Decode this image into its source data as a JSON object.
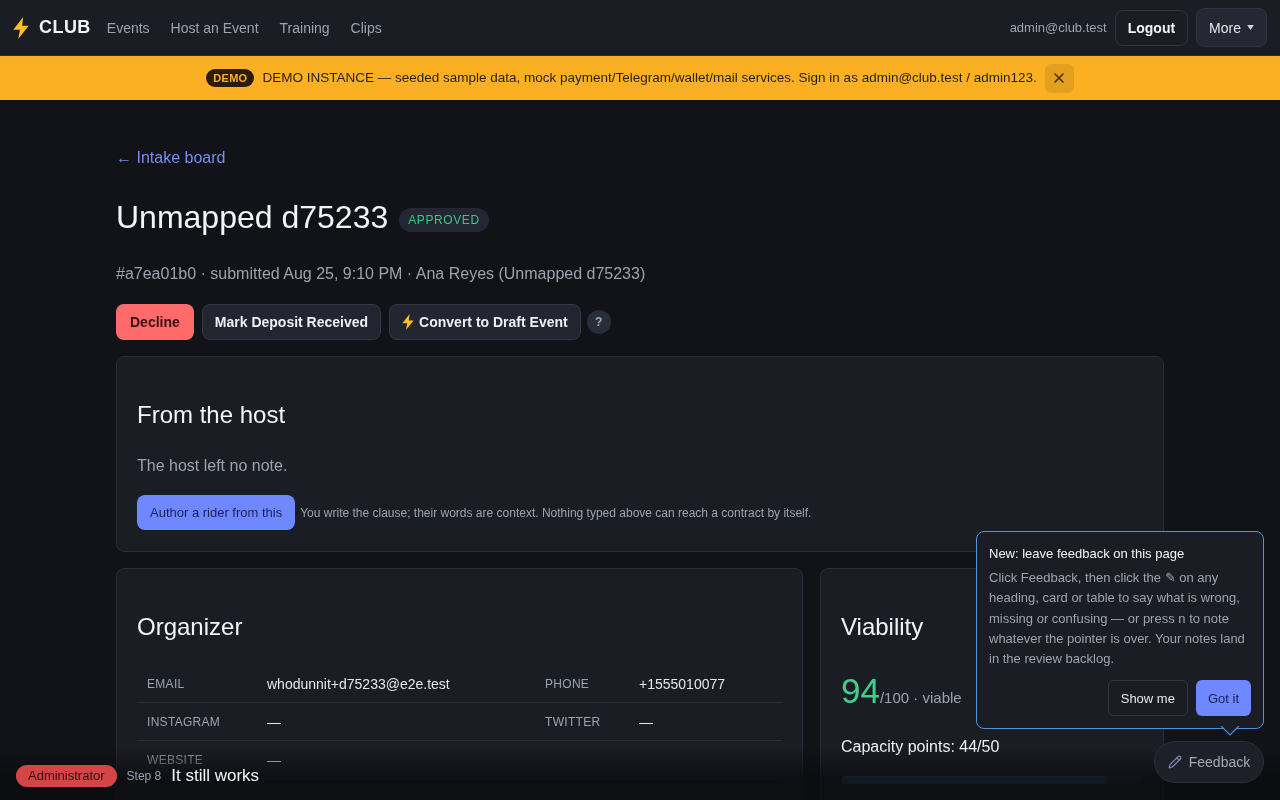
{
  "nav": {
    "logo": "CLUB",
    "links": [
      {
        "label": "Events"
      },
      {
        "label": "Host an Event"
      },
      {
        "label": "Training"
      },
      {
        "label": "Clips"
      }
    ],
    "user_email": "admin@club.test",
    "logout": "Logout",
    "more": "More"
  },
  "banner": {
    "badge": "DEMO",
    "text": "DEMO INSTANCE — seeded sample data, mock payment/Telegram/wallet/mail services. Sign in as admin@club.test / admin123."
  },
  "back_link": "← Intake board",
  "title": "Unmapped d75233",
  "status": "APPROVED",
  "meta": "#a7ea01b0 · submitted Aug 25, 9:10 PM · Ana Reyes (Unmapped d75233)",
  "actions": [
    {
      "label": "Decline",
      "kind": "danger"
    },
    {
      "label": "Mark Deposit Received",
      "kind": "plain"
    },
    {
      "label": "Convert to Draft Event",
      "kind": "flash"
    },
    {
      "label": "?",
      "kind": "help"
    }
  ],
  "host_card": {
    "title": "From the host",
    "note": "The host left no note.",
    "button": "Author a rider from this",
    "hint": "You write the clause; their words are context. Nothing typed above can reach a contract by itself."
  },
  "organizer": {
    "title": "Organizer",
    "rows": [
      {
        "cells": [
          {
            "label": "EMAIL",
            "value": "whodunnit+d75233@e2e.test"
          },
          {
            "label": "PHONE",
            "value": "+1555010077"
          }
        ]
      },
      {
        "cells": [
          {
            "label": "INSTAGRAM",
            "value": "—"
          },
          {
            "label": "TWITTER",
            "value": "—"
          }
        ]
      },
      {
        "cells": [
          {
            "label": "WEBSITE",
            "value": "—"
          }
        ]
      }
    ]
  },
  "viability": {
    "title": "Viability",
    "score": "94",
    "suffix": "/100 · viable",
    "capacity": "Capacity points: 44/50",
    "level": 0.88
  },
  "popover": {
    "title": "New: leave feedback on this page",
    "body": "Click Feedback, then click the ✎ on any heading, card or table to say what is wrong, missing or confusing — or press n to note whatever the pointer is over. Your notes land in the review backlog.",
    "buttons": [
      {
        "label": "Show me",
        "kind": "secondary"
      },
      {
        "label": "Got it",
        "kind": "primary"
      }
    ]
  },
  "feedback_button": "Feedback",
  "footer": {
    "role": "Administrator",
    "step": "Step 8",
    "step_title": "It still works"
  }
}
